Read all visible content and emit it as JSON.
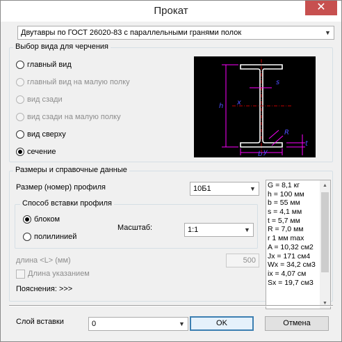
{
  "window": {
    "title": "Прокат",
    "close_glyph": "✕"
  },
  "profile_type": {
    "selected": "Двутавры по ГОСТ 26020-83 с параллельными гранями полок",
    "arrow": "▼"
  },
  "view_group": {
    "title": "Выбор вида для черчения",
    "options": [
      {
        "label": "главный вид",
        "checked": false,
        "enabled": true
      },
      {
        "label": "главный вид на малую полку",
        "checked": false,
        "enabled": false
      },
      {
        "label": "вид сзади",
        "checked": false,
        "enabled": false
      },
      {
        "label": "вид сзади на малую полку",
        "checked": false,
        "enabled": false
      },
      {
        "label": "вид сверху",
        "checked": false,
        "enabled": true
      },
      {
        "label": "сечение",
        "checked": true,
        "enabled": true
      }
    ]
  },
  "preview_labels": {
    "b": "b",
    "h": "h",
    "s": "s",
    "x": "x",
    "y": "y",
    "t": "t",
    "r": "R"
  },
  "sizes_group": {
    "title": "Размеры и справочные данные",
    "size_label": "Размер (номер) профиля",
    "size_value": "10Б1",
    "insert_group_title": "Способ вставки профиля",
    "insert_options": [
      {
        "label": "блоком",
        "checked": true
      },
      {
        "label": "полилинией",
        "checked": false
      }
    ],
    "scale_label": "Масштаб:",
    "scale_value": "1:1",
    "length_label": "длина <L> (мм)",
    "length_value": "500",
    "length_check_label": "Длина указанием",
    "notes_label": "Пояснения: >>>"
  },
  "properties": [
    "G = 8,1 кг",
    "h = 100 мм",
    "b = 55 мм",
    "s = 4,1 мм",
    "t = 5,7 мм",
    "R = 7,0 мм",
    "r 1 мм max",
    "A = 10,32 см2",
    "Jx = 171 см4",
    "Wx = 34,2 см3",
    "ix = 4,07 см",
    "Sx = 19,7 см3"
  ],
  "bottom": {
    "layer_label": "Слой вставки",
    "layer_value": "0",
    "ok_label": "OK",
    "cancel_label": "Отмена"
  },
  "colors": {
    "close": "#c7504f",
    "preview_bg": "#000000",
    "section": "#ffffff",
    "dims": "#ff00ff",
    "text": "#0000ff",
    "axes": "#ff0000"
  }
}
